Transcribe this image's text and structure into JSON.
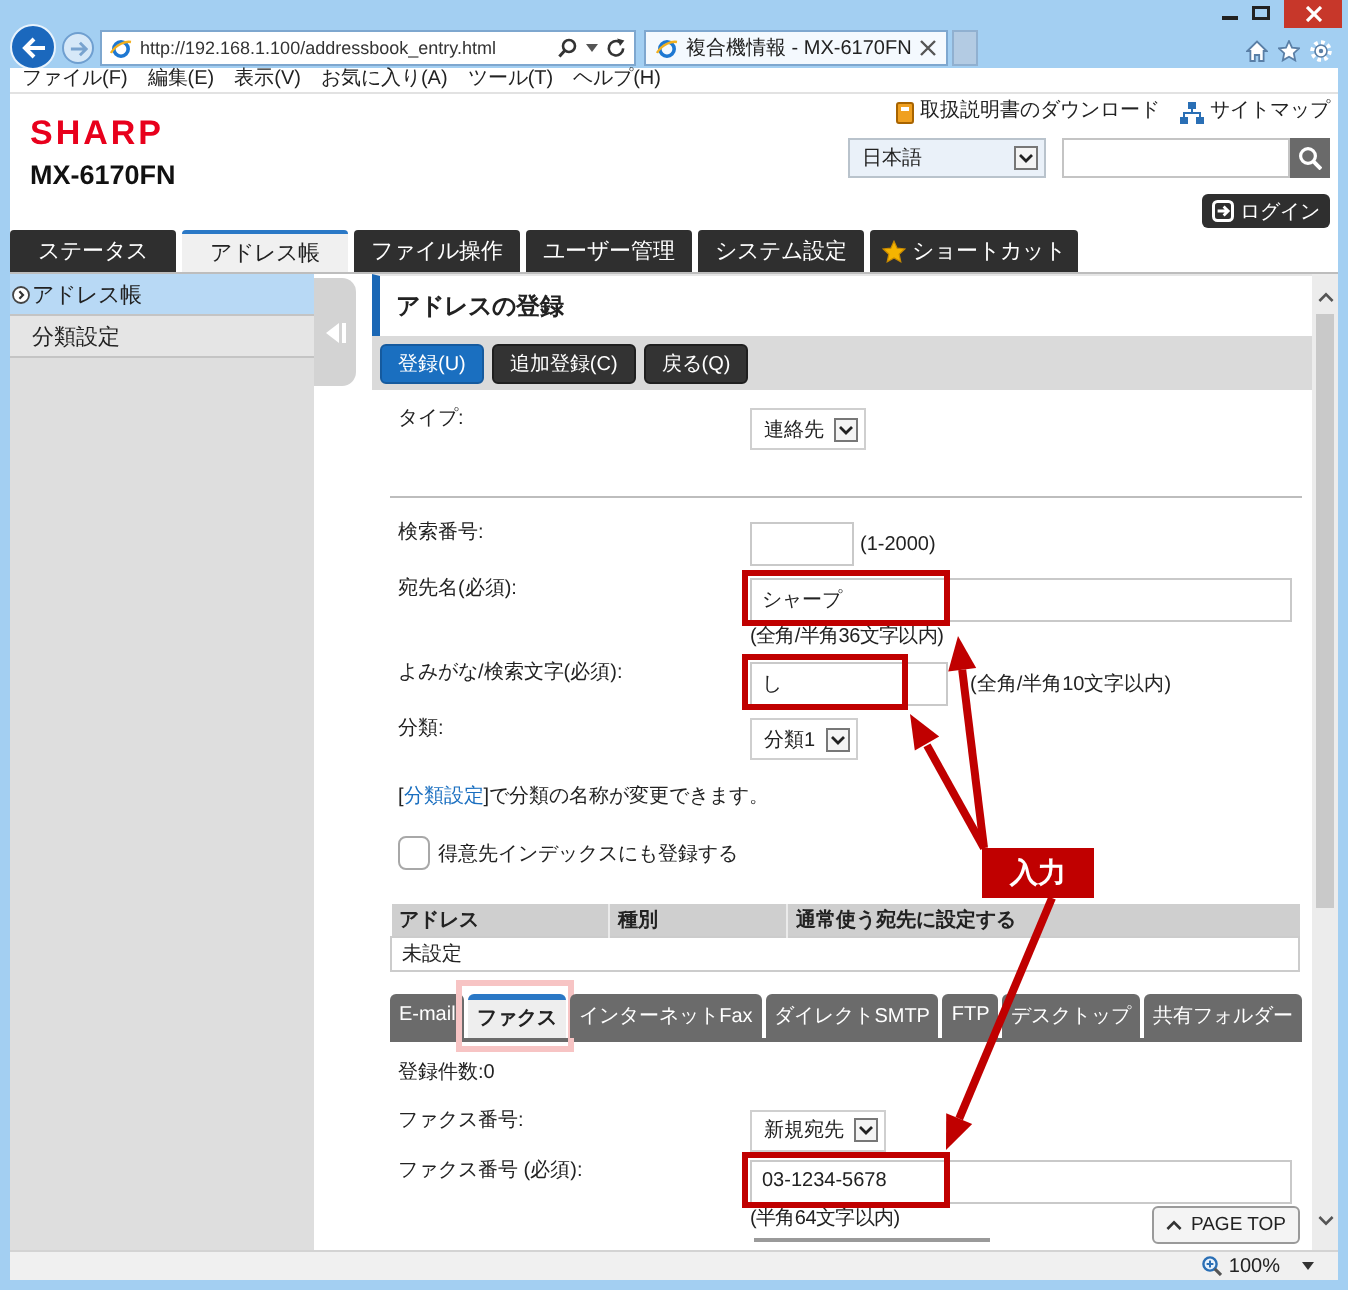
{
  "browser": {
    "address": "http://192.168.1.100/addressbook_entry.html",
    "tab_title": "複合機情報 - MX-6170FN",
    "forward": {
      "disabled": true
    },
    "menu": [
      "ファイル(F)",
      "編集(E)",
      "表示(V)",
      "お気に入り(A)",
      "ツール(T)",
      "ヘルプ(H)"
    ],
    "zoom": "100%"
  },
  "header": {
    "logo": "SHARP",
    "model": "MX-6170FN",
    "links": [
      {
        "kind": "manual",
        "label": "取扱説明書のダウンロード"
      },
      {
        "kind": "sitemap",
        "label": "サイトマップ"
      }
    ],
    "language": "日本語",
    "login": "ログイン"
  },
  "nav_tabs": [
    {
      "label": "ステータス",
      "kind": "page",
      "selected": false
    },
    {
      "label": "アドレス帳",
      "kind": "page",
      "selected": true
    },
    {
      "label": "ファイル操作",
      "kind": "page",
      "selected": false
    },
    {
      "label": "ユーザー管理",
      "kind": "page",
      "selected": false
    },
    {
      "label": "システム設定",
      "kind": "page",
      "selected": false
    },
    {
      "label": "ショートカット",
      "kind": "shortcut",
      "selected": false
    }
  ],
  "sidebar": {
    "items": [
      {
        "label": "アドレス帳",
        "selected": true
      },
      {
        "label": "分類設定",
        "selected": false
      }
    ]
  },
  "page": {
    "title": "アドレスの登録",
    "toolbar": [
      {
        "label": "登録(U)",
        "primary": true
      },
      {
        "label": "追加登録(C)",
        "primary": false
      },
      {
        "label": "戻る(Q)",
        "primary": false
      }
    ],
    "type_field": {
      "label": "タイプ:",
      "value": "連絡先"
    },
    "fields": [
      {
        "kind": "number",
        "label": "検索番号:",
        "hint": "(1-2000)",
        "highlighted": false
      },
      {
        "kind": "text",
        "label": "宛先名(必須):",
        "value": "シャープ",
        "note": "(全角/半角36文字以内)",
        "highlighted": true
      },
      {
        "kind": "kana",
        "label": "よみがな/検索文字(必須):",
        "value": "し",
        "hint": "(全角/半角10文字以内)",
        "highlighted": true
      },
      {
        "kind": "select",
        "label": "分類:",
        "value": "分類1"
      }
    ],
    "info": {
      "before": "[",
      "link": "分類設定",
      "after": "]で分類の名称が変更できます。"
    },
    "index_checkbox": {
      "label": "得意先インデックスにも登録する",
      "checked": false
    },
    "address_table": {
      "columns": [
        "アドレス",
        "種別",
        "通常使う宛先に設定する"
      ],
      "rows": [
        [
          "未設定"
        ]
      ]
    },
    "sub_tabs": [
      {
        "label": "E-mail",
        "selected": false,
        "highlighted": false
      },
      {
        "label": "ファクス",
        "selected": true,
        "highlighted": true
      },
      {
        "label": "インターネットFax",
        "selected": false,
        "highlighted": false
      },
      {
        "label": "ダイレクトSMTP",
        "selected": false,
        "highlighted": false
      },
      {
        "label": "FTP",
        "selected": false,
        "highlighted": false
      },
      {
        "label": "デスクトップ",
        "selected": false,
        "highlighted": false
      },
      {
        "label": "共有フォルダー",
        "selected": false,
        "highlighted": false
      }
    ],
    "fax": {
      "count": "登録件数:0",
      "fields": [
        {
          "kind": "select",
          "label": "ファクス番号:",
          "value": "新規宛先"
        },
        {
          "kind": "text",
          "label": "ファクス番号 (必須):",
          "value": "03-1234-5678",
          "note": "(半角64文字以内)",
          "highlighted": true
        }
      ]
    },
    "page_top": "PAGE TOP"
  },
  "callout": {
    "label": "入力"
  }
}
